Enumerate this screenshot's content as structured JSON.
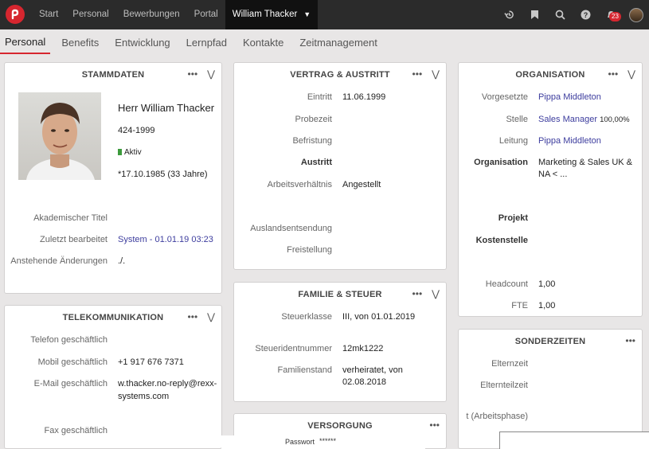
{
  "topbar": {
    "nav": [
      "Start",
      "Personal",
      "Bewerbungen",
      "Portal"
    ],
    "active_nav": "William Thacker",
    "notifications_count": "23"
  },
  "tabs": [
    "Personal",
    "Benefits",
    "Entwicklung",
    "Lernpfad",
    "Kontakte",
    "Zeitmanagement"
  ],
  "stammdaten": {
    "title": "STAMMDATEN",
    "name": "Herr William Thacker",
    "id": "424-1999",
    "status": "Aktiv",
    "birth": "*17.10.1985 (33 Jahre)",
    "rows": [
      {
        "label": "Akademischer Titel",
        "value": ""
      },
      {
        "label": "Zuletzt bearbeitet",
        "value": "System - 01.01.19 03:23"
      },
      {
        "label": "Anstehende Änderungen",
        "value": "./."
      }
    ]
  },
  "telekom": {
    "title": "TELEKOMMUNIKATION",
    "rows": [
      {
        "label": "Telefon geschäftlich",
        "value": ""
      },
      {
        "label": "Mobil geschäftlich",
        "value": "+1 917 676 7371"
      },
      {
        "label": "E-Mail geschäftlich",
        "value": "w.thacker.no-reply@rexx-",
        "value2": "systems.com"
      },
      {
        "label": "Fax geschäftlich",
        "value": ""
      }
    ]
  },
  "vertrag": {
    "title": "VERTRAG & AUSTRITT",
    "rows": [
      {
        "label": "Eintritt",
        "value": "11.06.1999"
      },
      {
        "label": "Probezeit",
        "value": ""
      },
      {
        "label": "Befristung",
        "value": ""
      },
      {
        "label": "Austritt",
        "value": ""
      },
      {
        "label": "Arbeitsverhältnis",
        "value": "Angestellt"
      },
      {
        "label": "Auslandsentsendung",
        "value": ""
      },
      {
        "label": "Freistellung",
        "value": ""
      }
    ]
  },
  "familie": {
    "title": "FAMILIE & STEUER",
    "rows": [
      {
        "label": "Steuerklasse",
        "value": "III, von 01.01.2019"
      },
      {
        "label": "Steueridentnummer",
        "value": "12mk1222"
      },
      {
        "label": "Familienstand",
        "value": "verheiratet, von",
        "value2": "02.08.2018"
      }
    ]
  },
  "versorgung": {
    "title": "VERSORGUNG",
    "password_label": "Passwort",
    "password_value": "******"
  },
  "organisation": {
    "title": "ORGANISATION",
    "rows": [
      {
        "label": "Vorgesetzte",
        "value": "Pippa Middleton"
      },
      {
        "label": "Stelle",
        "value": "Sales Manager",
        "extra": "100,00%"
      },
      {
        "label": "Leitung",
        "value": "Pippa Middleton"
      },
      {
        "label": "Organisation",
        "value": "Marketing & Sales UK &",
        "value2": "NA < ..."
      },
      {
        "label": "Projekt",
        "value": ""
      },
      {
        "label": "Kostenstelle",
        "value": ""
      },
      {
        "label": "Headcount",
        "value": "1,00"
      },
      {
        "label": "FTE",
        "value": "1,00"
      }
    ]
  },
  "sonderzeiten": {
    "title": "SONDERZEITEN",
    "rows": [
      {
        "label": "Elternzeit"
      },
      {
        "label": "Elternteilzeit"
      },
      {
        "label": "t (Arbeitsphase)"
      }
    ]
  },
  "icons": [
    "history-icon",
    "bookmark-icon",
    "search-icon",
    "help-icon",
    "bell-icon",
    "user-avatar"
  ]
}
